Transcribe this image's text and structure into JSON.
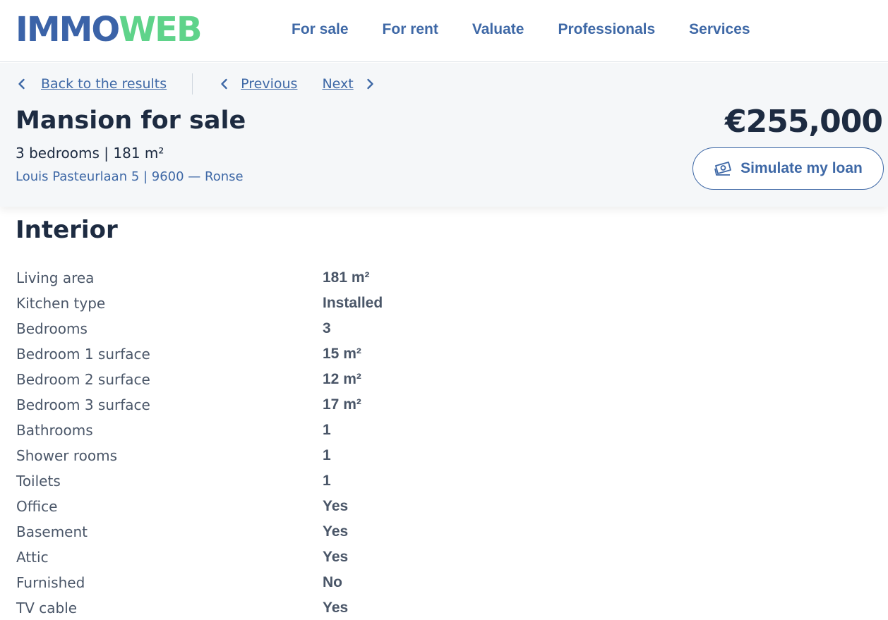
{
  "brand": {
    "logo_part1": "IMMO",
    "logo_part2": "WEB",
    "color_primary": "#3b63a8",
    "color_accent": "#5fd38a"
  },
  "nav": {
    "items": [
      {
        "label": "For sale"
      },
      {
        "label": "For rent"
      },
      {
        "label": "Valuate"
      },
      {
        "label": "Professionals"
      },
      {
        "label": "Services"
      }
    ]
  },
  "breadcrumb": {
    "back_label": "Back to the results",
    "previous_label": "Previous",
    "next_label": "Next"
  },
  "listing": {
    "title": "Mansion for sale",
    "summary": "3 bedrooms | 181 m²",
    "address": "Louis Pasteurlaan 5 | 9600 — Ronse",
    "price": "€255,000",
    "loan_button_label": "Simulate my loan",
    "loan_icon": "money-icon"
  },
  "interior": {
    "heading": "Interior",
    "rows": [
      {
        "label": "Living area",
        "value": "181 m²"
      },
      {
        "label": "Kitchen type",
        "value": "Installed"
      },
      {
        "label": "Bedrooms",
        "value": "3"
      },
      {
        "label": "Bedroom 1 surface",
        "value": "15 m²"
      },
      {
        "label": "Bedroom 2 surface",
        "value": "12 m²"
      },
      {
        "label": "Bedroom 3 surface",
        "value": "17 m²"
      },
      {
        "label": "Bathrooms",
        "value": "1"
      },
      {
        "label": "Shower rooms",
        "value": "1"
      },
      {
        "label": "Toilets",
        "value": "1"
      },
      {
        "label": "Office",
        "value": "Yes"
      },
      {
        "label": "Basement",
        "value": "Yes"
      },
      {
        "label": "Attic",
        "value": "Yes"
      },
      {
        "label": "Furnished",
        "value": "No"
      },
      {
        "label": "TV cable",
        "value": "Yes"
      }
    ]
  }
}
